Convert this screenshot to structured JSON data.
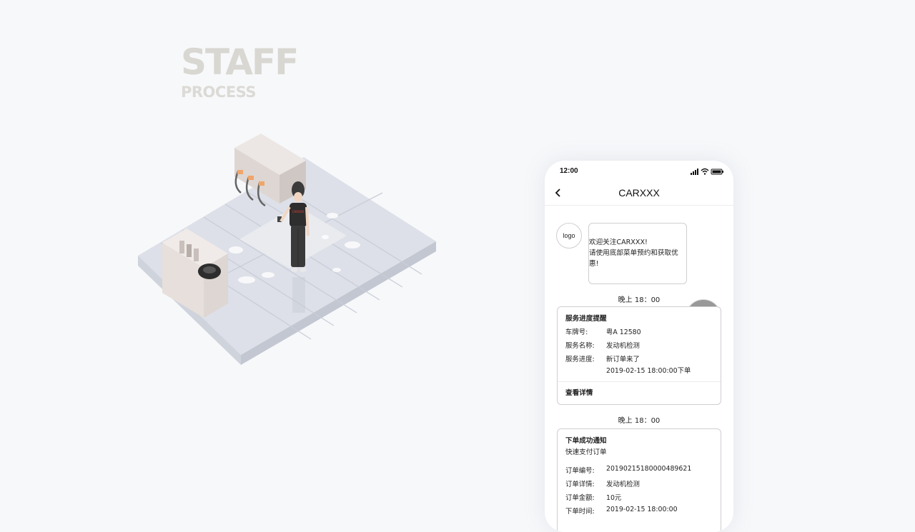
{
  "hero": {
    "title": "STAFF",
    "subtitle": "PROCESS"
  },
  "scene": {
    "shirt_text": "CARXXX"
  },
  "phone": {
    "status_time": "12:00",
    "nav_title": "CARXXX",
    "avatar_label": "logo",
    "welcome_line1": "欢迎关注CARXXX!",
    "welcome_line2": "请使用底部菜单预约和获取优惠!",
    "time1": "晚上 18：00",
    "card1": {
      "title": "服务进度提醒",
      "rows": [
        {
          "k": "车牌号:",
          "v": "粤A 12580"
        },
        {
          "k": "服务名称:",
          "v": "发动机检测"
        },
        {
          "k": "服务进度:",
          "v": "新订单来了"
        }
      ],
      "extra": "2019-02-15 18:00:00下单",
      "link": "查看详情"
    },
    "time2": "晚上 18：00",
    "card2": {
      "title": "下单成功通知",
      "subtitle": "快速支付订单",
      "rows": [
        {
          "k": "订单编号:",
          "v": "20190215180000489621"
        },
        {
          "k": "订单详情:",
          "v": "发动机检测"
        },
        {
          "k": "订单金额:",
          "v": "10元"
        },
        {
          "k": "下单时间:",
          "v": "2019-02-15 18:00:00"
        }
      ]
    }
  }
}
